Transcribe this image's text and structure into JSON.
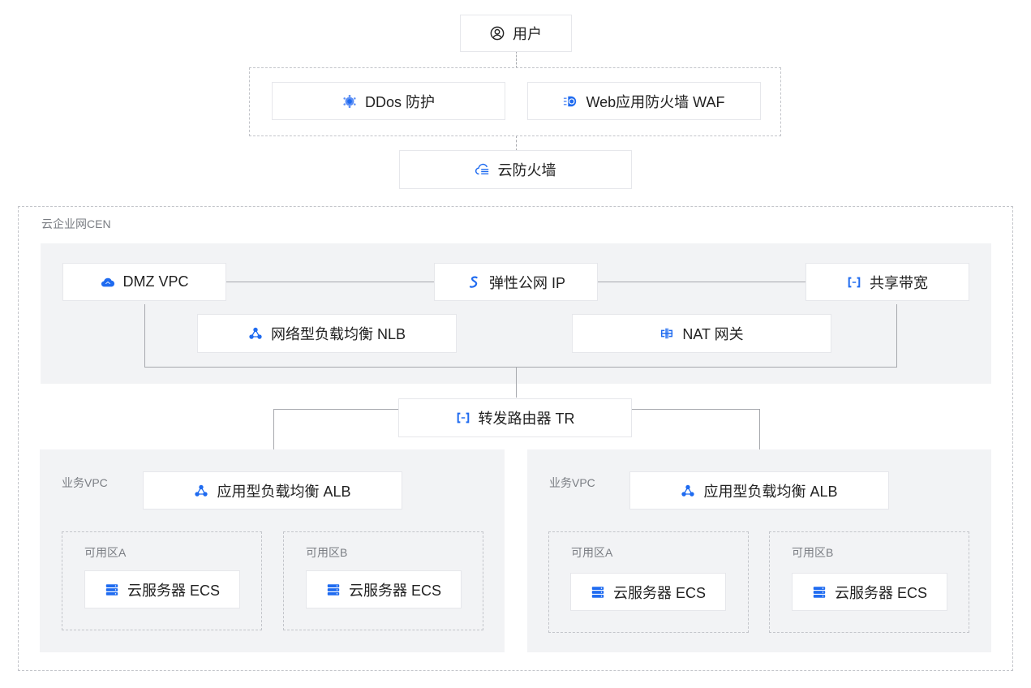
{
  "colors": {
    "accent": "#1f6bf0",
    "panel": "#f2f3f5",
    "line": "#a6a8ad",
    "dashed": "#c3c5ca"
  },
  "top": {
    "user": {
      "label": "用户",
      "icon": "user-circle-icon"
    },
    "protection": [
      {
        "label": "DDos 防护",
        "icon": "ddos-shield-icon"
      },
      {
        "label": "Web应用防火墙 WAF",
        "icon": "waf-icon"
      }
    ],
    "cloud_firewall": {
      "label": "云防火墙",
      "icon": "cloud-firewall-icon"
    }
  },
  "cen": {
    "title": "云企业网CEN",
    "dmz": {
      "vpc": {
        "label": "DMZ VPC",
        "icon": "cloud-vpc-icon"
      },
      "eip": {
        "label": "弹性公网 IP",
        "icon": "eip-icon"
      },
      "bandwidth": {
        "label": "共享带宽",
        "icon": "bracket-icon"
      },
      "nlb": {
        "label": "网络型负载均衡 NLB",
        "icon": "load-balancer-icon"
      },
      "nat": {
        "label": "NAT 网关",
        "icon": "nat-gateway-icon"
      }
    },
    "tr": {
      "label": "转发路由器 TR",
      "icon": "bracket-icon"
    },
    "business_vpcs": [
      {
        "title": "业务VPC",
        "alb": {
          "label": "应用型负载均衡 ALB",
          "icon": "load-balancer-icon"
        },
        "zones": [
          {
            "title": "可用区A",
            "ecs": {
              "label": "云服务器 ECS",
              "icon": "server-icon"
            }
          },
          {
            "title": "可用区B",
            "ecs": {
              "label": "云服务器 ECS",
              "icon": "server-icon"
            }
          }
        ]
      },
      {
        "title": "业务VPC",
        "alb": {
          "label": "应用型负载均衡 ALB",
          "icon": "load-balancer-icon"
        },
        "zones": [
          {
            "title": "可用区A",
            "ecs": {
              "label": "云服务器 ECS",
              "icon": "server-icon"
            }
          },
          {
            "title": "可用区B",
            "ecs": {
              "label": "云服务器 ECS",
              "icon": "server-icon"
            }
          }
        ]
      }
    ]
  }
}
